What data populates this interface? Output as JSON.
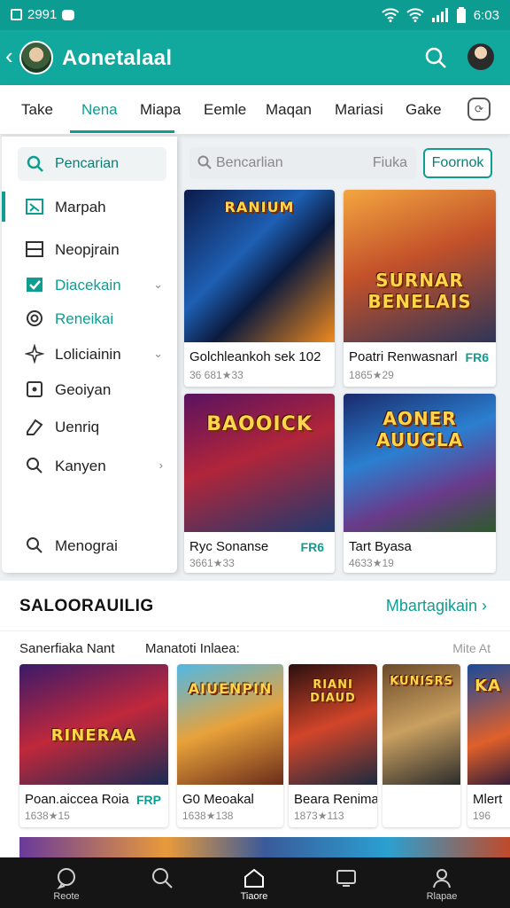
{
  "status": {
    "left_text": "2991",
    "time": "6:03"
  },
  "app": {
    "title": "Aonetalaal"
  },
  "tabs": [
    "Take",
    "Nena",
    "Miapa",
    "Eemle",
    "Maqan",
    "Mariasi",
    "Gake"
  ],
  "sidebar": {
    "search": "Pencarian",
    "items": [
      {
        "label": "Marpah"
      },
      {
        "label": "Neopjrain"
      },
      {
        "label": "Diacekain"
      },
      {
        "label": "Reneikai"
      },
      {
        "label": "Loliciainin"
      },
      {
        "label": "Geoiyan"
      },
      {
        "label": "Uenriq"
      },
      {
        "label": "Kanyen"
      },
      {
        "label": "Menograi"
      }
    ]
  },
  "main_search": {
    "placeholder": "Bencarlian",
    "hint": "Fiuka"
  },
  "filter_button": "Foornok",
  "grid": [
    {
      "art": "RANIUM",
      "name": "Golchleankoh sek 102",
      "price": "",
      "meta": "36 681★33"
    },
    {
      "art": "SURNAR BENELAIS",
      "name": "Poatri Renwasnarl",
      "price": "FR6",
      "meta": "1865★29"
    },
    {
      "art": "BAOOICK",
      "name": "Ryc Sonanse",
      "price": "FR6",
      "meta": "3661★33"
    },
    {
      "art": "AONER AUUGLA",
      "name": "Tart Byasa",
      "price": "",
      "meta": "4633★19"
    }
  ],
  "section": {
    "title": "SALOORAUILIG",
    "more": "Mbartagikain",
    "sub_left": "Sanerfiaka  Nant",
    "sub_mid": "Manatoti Inlaea:",
    "sub_right": "Mite At"
  },
  "row": [
    {
      "art": "RINERAA",
      "name": "Poan.aiccea Roia",
      "price": "FRP",
      "meta": "1638★15"
    },
    {
      "art": "AIUENPIN",
      "name": "G0 Meoakal",
      "price": "",
      "meta": "1638★138"
    },
    {
      "art": "RIANI DIAUD",
      "name": "Beara Renimanlenlada",
      "price": "",
      "meta": "1873★113"
    },
    {
      "art": "KUNISRS",
      "name": "",
      "price": "",
      "meta": ""
    },
    {
      "art": "KA",
      "name": "Mlert",
      "price": "",
      "meta": "196"
    }
  ],
  "bottom_nav": [
    "Reote",
    "",
    "Tiaore",
    "",
    "Rlapae"
  ],
  "colors": {
    "teal": "#11a89d",
    "accent": "#0f9d91",
    "navbar": "#151515"
  }
}
